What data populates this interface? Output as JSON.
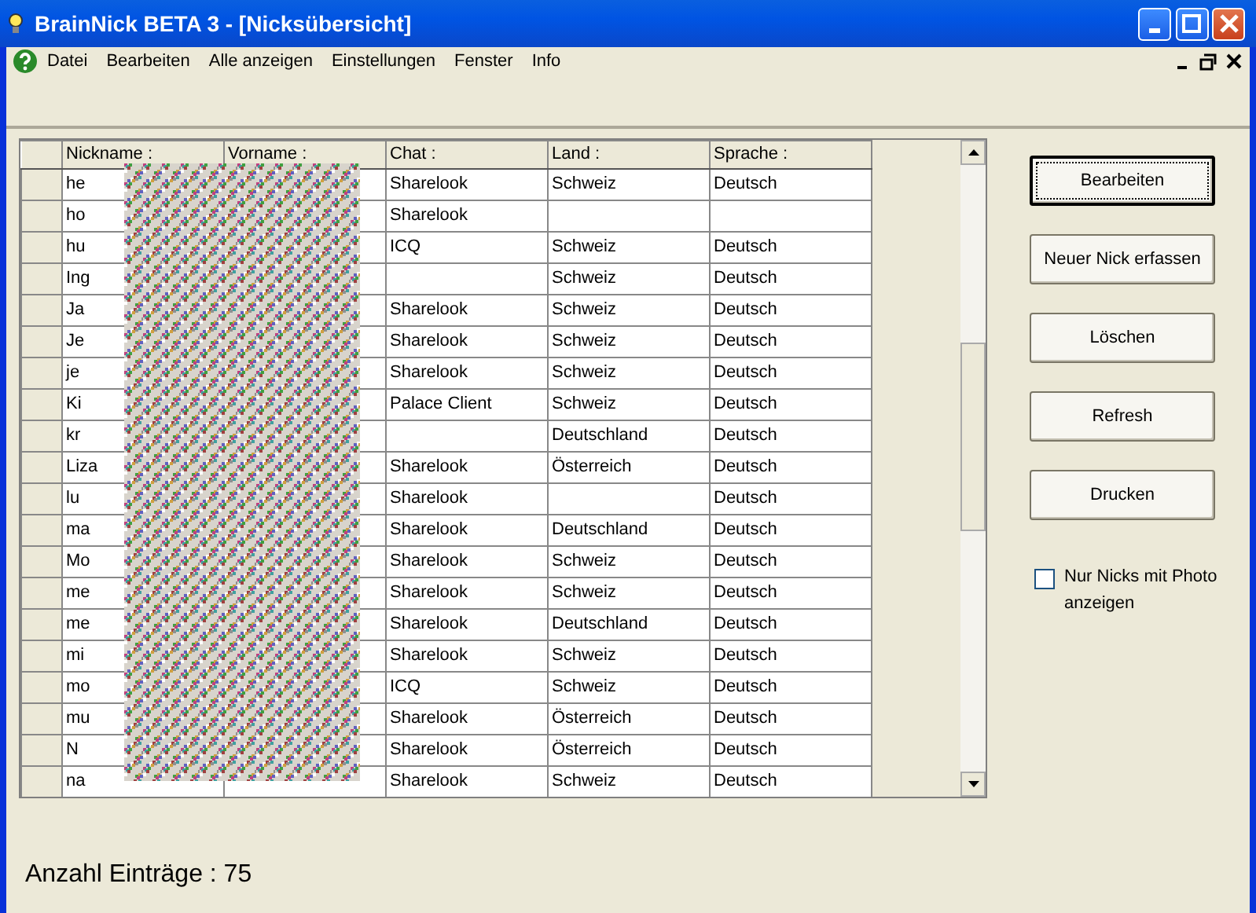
{
  "window": {
    "title": "BrainNick BETA 3 - [Nicksübersicht]"
  },
  "menu": [
    "Datei",
    "Bearbeiten",
    "Alle anzeigen",
    "Einstellungen",
    "Fenster",
    "Info"
  ],
  "table": {
    "columns": [
      "Nickname :",
      "Vorname :",
      "Chat :",
      "Land :",
      "Sprache :"
    ],
    "rows": [
      {
        "nickname": "he",
        "chat": "Sharelook",
        "land": "Schweiz",
        "sprache": "Deutsch"
      },
      {
        "nickname": "ho",
        "chat": "Sharelook"
      },
      {
        "nickname": "hu",
        "chat": "ICQ",
        "land": "Schweiz",
        "sprache": "Deutsch"
      },
      {
        "nickname": "Ing",
        "land": "Schweiz",
        "sprache": "Deutsch"
      },
      {
        "nickname": "Ja",
        "chat": "Sharelook",
        "land": "Schweiz",
        "sprache": "Deutsch"
      },
      {
        "nickname": "Je",
        "chat": "Sharelook",
        "land": "Schweiz",
        "sprache": "Deutsch"
      },
      {
        "nickname": "je",
        "chat": "Sharelook",
        "land": "Schweiz",
        "sprache": "Deutsch"
      },
      {
        "nickname": "Ki",
        "chat": "Palace Client",
        "land": "Schweiz",
        "sprache": "Deutsch"
      },
      {
        "nickname": "kr",
        "land": "Deutschland",
        "sprache": "Deutsch"
      },
      {
        "nickname": "Liza",
        "chat": "Sharelook",
        "land": "Österreich",
        "sprache": "Deutsch"
      },
      {
        "nickname": "lu",
        "chat": "Sharelook",
        "sprache": "Deutsch"
      },
      {
        "nickname": "ma",
        "chat": "Sharelook",
        "land": "Deutschland",
        "sprache": "Deutsch"
      },
      {
        "nickname": "Mo",
        "chat": "Sharelook",
        "land": "Schweiz",
        "sprache": "Deutsch"
      },
      {
        "nickname": "me",
        "chat": "Sharelook",
        "land": "Schweiz",
        "sprache": "Deutsch"
      },
      {
        "nickname": "me",
        "chat": "Sharelook",
        "land": "Deutschland",
        "sprache": "Deutsch"
      },
      {
        "nickname": "mi",
        "chat": "Sharelook",
        "land": "Schweiz",
        "sprache": "Deutsch"
      },
      {
        "nickname": "mo",
        "chat": "ICQ",
        "land": "Schweiz",
        "sprache": "Deutsch"
      },
      {
        "nickname": "mu",
        "chat": "Sharelook",
        "land": "Österreich",
        "sprache": "Deutsch"
      },
      {
        "nickname": "N",
        "chat": "Sharelook",
        "land": "Österreich",
        "sprache": "Deutsch"
      },
      {
        "nickname": "na",
        "chat": "Sharelook",
        "land": "Schweiz",
        "sprache": "Deutsch"
      }
    ]
  },
  "buttons": [
    {
      "label": "Bearbeiten",
      "default": true
    },
    {
      "label": "Neuer Nick erfassen",
      "default": false
    },
    {
      "label": "Löschen",
      "default": false
    },
    {
      "label": "Refresh",
      "default": false
    },
    {
      "label": "Drucken",
      "default": false
    }
  ],
  "photo_filter": {
    "label": "Nur Nicks mit Photo anzeigen",
    "checked": false
  },
  "status": "Anzahl Einträge : 75"
}
